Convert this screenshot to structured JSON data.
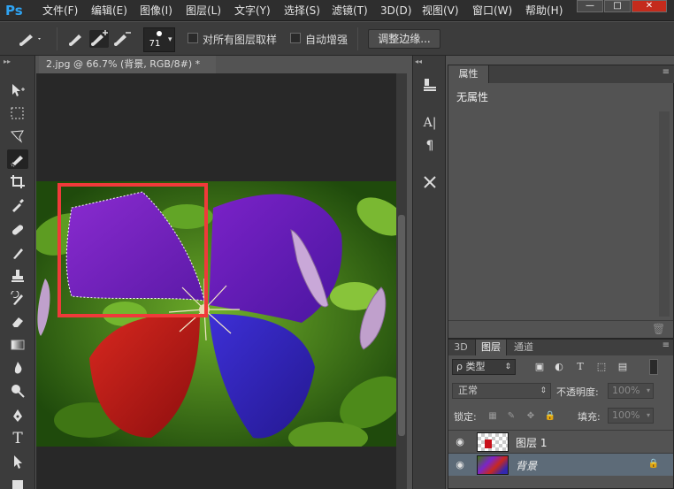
{
  "app": {
    "logo": "Ps"
  },
  "menu": [
    "文件(F)",
    "编辑(E)",
    "图像(I)",
    "图层(L)",
    "文字(Y)",
    "选择(S)",
    "滤镜(T)",
    "3D(D)",
    "视图(V)",
    "窗口(W)",
    "帮助(H)"
  ],
  "window_controls": {
    "minimize": "—",
    "restore": "□",
    "close": "✕"
  },
  "options": {
    "brush_size": "71",
    "sample_all_layers_label": "对所有图层取样",
    "auto_enhance_label": "自动增强",
    "refine_edge_label": "调整边缘..."
  },
  "document": {
    "tab_title": "2.jpg @ 66.7% (背景, RGB/8#) *"
  },
  "tools": [
    "move-tool",
    "marquee-tool",
    "lasso-tool",
    "quick-selection-tool",
    "crop-tool",
    "eyedropper-tool",
    "healing-brush-tool",
    "brush-tool",
    "clone-stamp-tool",
    "history-brush-tool",
    "eraser-tool",
    "gradient-tool",
    "blur-tool",
    "dodge-tool",
    "pen-tool",
    "type-tool",
    "path-selection-tool"
  ],
  "properties": {
    "tab": "属性",
    "content": "无属性"
  },
  "layers_panel": {
    "tabs": [
      "3D",
      "图层",
      "通道"
    ],
    "active_tab": "图层",
    "filter_label": "ρ 类型",
    "blend_mode": "正常",
    "opacity_label": "不透明度:",
    "opacity_value": "100%",
    "lock_label": "锁定:",
    "fill_label": "填充:",
    "fill_value": "100%",
    "layers": [
      {
        "name": "图层 1",
        "selected": false
      },
      {
        "name": "背景",
        "selected": true
      }
    ]
  },
  "colors": {
    "selection_rect": "#f03a3a",
    "accent_logo": "#2fa4f3"
  }
}
